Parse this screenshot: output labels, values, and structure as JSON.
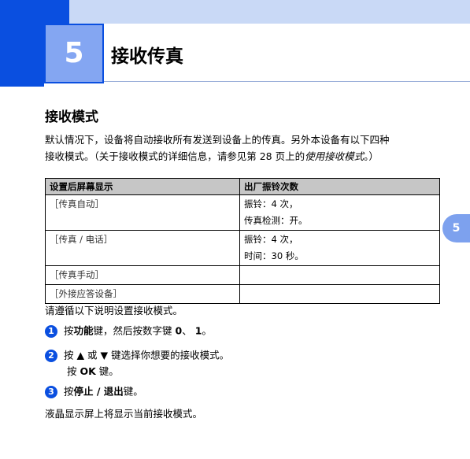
{
  "chapter": {
    "number": "5",
    "title": "接收传真",
    "side_tab": "5"
  },
  "section": {
    "title": "接收模式",
    "intro_line1": "默认情况下，设备将自动接收所有发送到设备上的传真。另外本设备有以下四种",
    "intro_line2_pre": "接收模式。（关于接收模式的详细信息，请参见第 28 页上的",
    "intro_line2_em": "使用接收模式",
    "intro_line2_post": "。）"
  },
  "table": {
    "headers": [
      "设置后屏幕显示",
      "出厂振铃次数"
    ],
    "rows": [
      {
        "mode": "［传真自动］",
        "lines": [
          "振铃：4 次，",
          "传真检测：开。"
        ]
      },
      {
        "mode": "［传真 / 电话］",
        "lines": [
          "振铃：4 次，",
          "时间：30 秒。"
        ]
      },
      {
        "mode": "［传真手动］",
        "lines": []
      },
      {
        "mode": "［外接应答设备］",
        "lines": []
      }
    ]
  },
  "instructions": "请遵循以下说明设置接收模式。",
  "steps": [
    {
      "number": "1",
      "pre": "按",
      "bold1": "功能",
      "mid": "键，然后按数字键 ",
      "bold2": "0",
      "mid2": "、 ",
      "bold3": "1",
      "post": "。"
    },
    {
      "number": "2",
      "line1": "按 ▲ 或 ▼ 键选择你想要的接收模式。",
      "line2_pre": "按 ",
      "line2_bold": "OK",
      "line2_post": " 键。"
    },
    {
      "number": "3",
      "pre": "按",
      "bold": "停止 / 退出",
      "post": "键。"
    }
  ],
  "final_note": "液晶显示屏上将显示当前接收模式。"
}
